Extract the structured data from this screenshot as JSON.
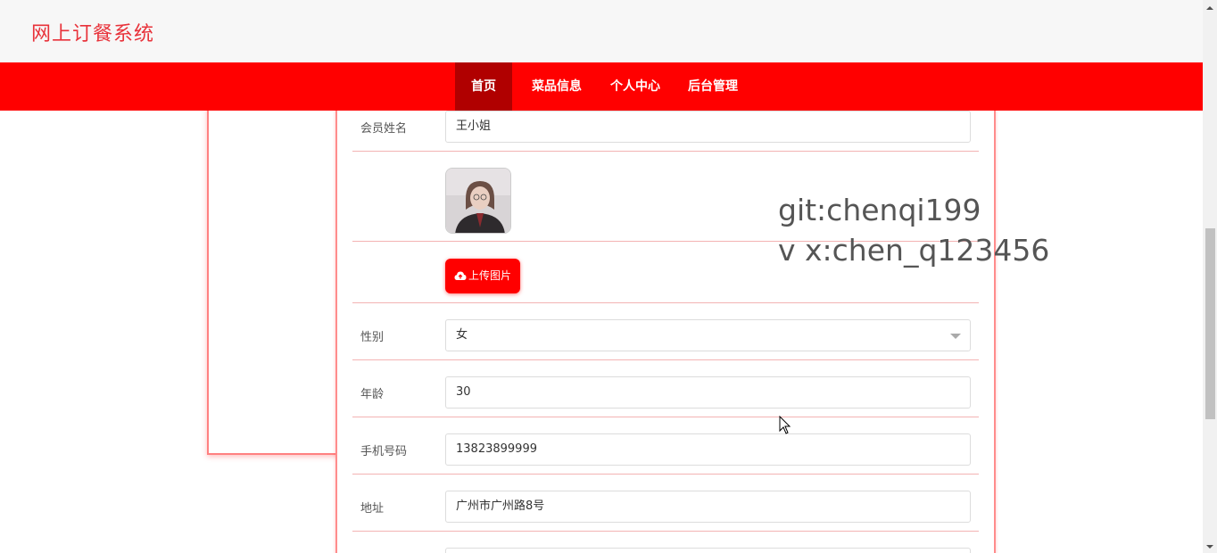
{
  "header": {
    "site_title": "网上订餐系统"
  },
  "nav": {
    "items": [
      "首页",
      "菜品信息",
      "个人中心",
      "后台管理"
    ],
    "active_index": 0
  },
  "form": {
    "member_name_label": "会员姓名",
    "member_name_value": "王小姐",
    "upload_button_label": "上传图片",
    "gender_label": "性别",
    "gender_value": "女",
    "age_label": "年龄",
    "age_value": "30",
    "phone_label": "手机号码",
    "phone_value": "13823899999",
    "address_label": "地址",
    "address_value": "广州市广州路8号"
  },
  "watermark": {
    "line1": "git:chenqi199",
    "line2": "v x:chen_q123456"
  },
  "icons": {
    "upload": "cloud-upload-icon",
    "select": "chevron-down-icon"
  },
  "colors": {
    "accent": "#ff0000",
    "title": "#e8323a",
    "nav_active": "#b00000",
    "divider": "#f3b3b3"
  }
}
